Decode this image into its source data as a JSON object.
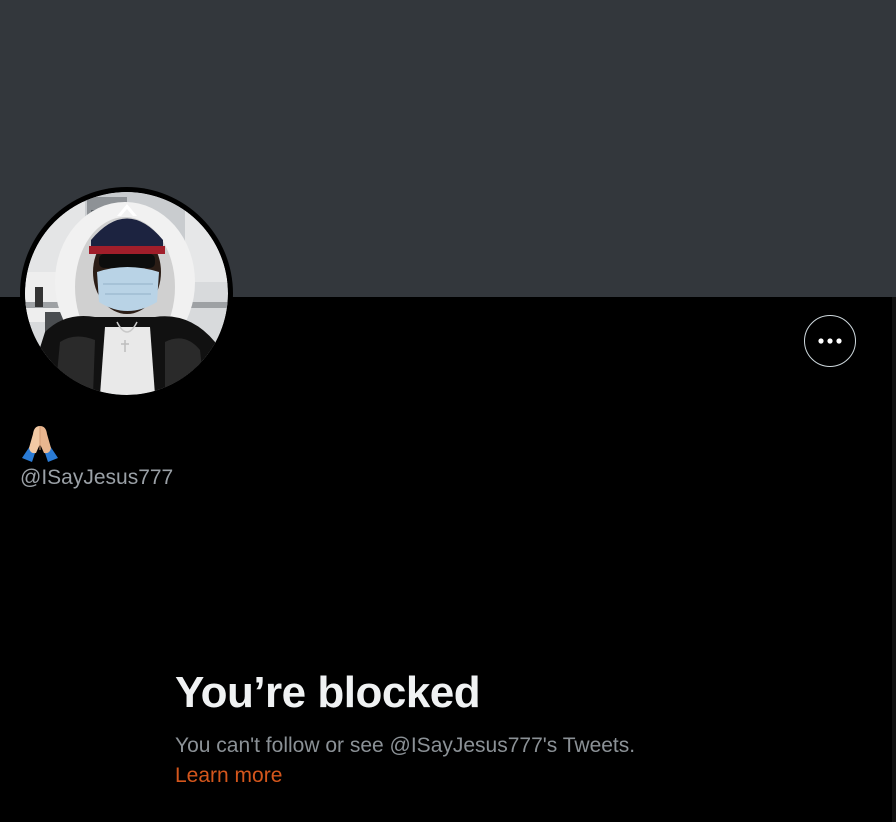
{
  "profile": {
    "display_name_icon": "folded-hands-emoji",
    "handle": "@ISayJesus777",
    "more_button_icon": "more-horizontal-icon"
  },
  "blocked": {
    "title": "You’re blocked",
    "message": "You can't follow or see @ISayJesus777's Tweets.",
    "learn_more": "Learn more"
  },
  "colors": {
    "banner": "#33373c",
    "background": "#000000",
    "link": "#d4561c",
    "secondary_text": "#8b9196"
  }
}
